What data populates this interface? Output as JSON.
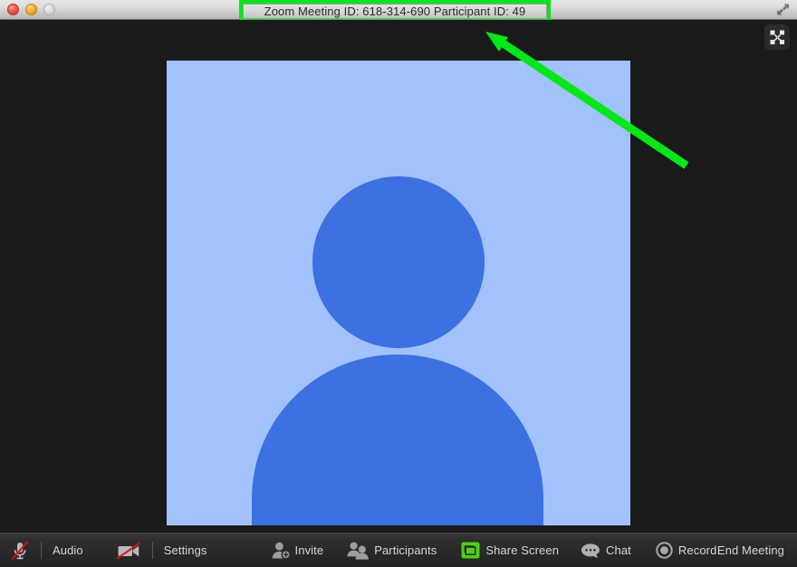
{
  "window": {
    "title": "Zoom Meeting ID: 618-314-690 Participant ID: 49",
    "meeting_id": "618-314-690",
    "participant_id": "49",
    "controls": {
      "close": "close-button",
      "minimize": "minimize-button",
      "zoom": "zoom-button"
    },
    "titlebar_fullscreen_icon": "fullscreen-expand-icon",
    "highlight_color": "#00e818"
  },
  "stage": {
    "fullscreen_button_icon": "fullscreen-icon",
    "participant_tile": {
      "avatar_icon": "default-user-avatar-icon",
      "background_color": "#a2c2fc",
      "figure_color": "#3d70e0"
    }
  },
  "annotation": {
    "arrow_color": "#00e818",
    "points_to": "window-title"
  },
  "toolbar": {
    "items": [
      {
        "name": "mute-audio-button",
        "icon": "microphone-muted-icon",
        "label": ""
      },
      {
        "name": "audio-button",
        "icon": "",
        "label": "Audio"
      },
      {
        "name": "stop-video-button",
        "icon": "video-camera-muted-icon",
        "label": ""
      },
      {
        "name": "settings-button",
        "icon": "",
        "label": "Settings"
      },
      {
        "name": "invite-button",
        "icon": "person-add-icon",
        "label": "Invite"
      },
      {
        "name": "participants-button",
        "icon": "people-icon",
        "label": "Participants"
      },
      {
        "name": "share-screen-button",
        "icon": "share-screen-icon",
        "label": "Share Screen"
      },
      {
        "name": "chat-button",
        "icon": "chat-bubble-icon",
        "label": "Chat"
      },
      {
        "name": "record-button",
        "icon": "record-circle-icon",
        "label": "Record"
      },
      {
        "name": "end-meeting-button",
        "icon": "",
        "label": "End Meeting"
      }
    ],
    "share_screen_accent": "#4bd219",
    "muted_slash_color": "#d81414"
  }
}
